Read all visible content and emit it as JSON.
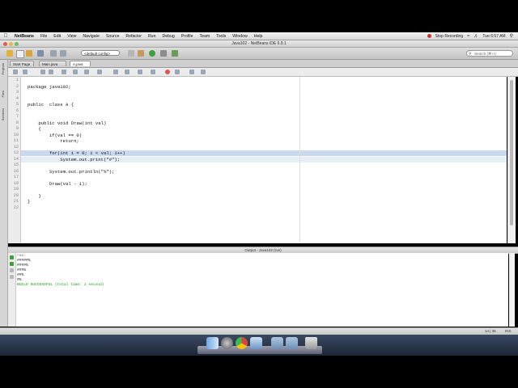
{
  "menubar": {
    "app_name": "NetBeans",
    "menus": [
      "File",
      "Edit",
      "View",
      "Navigate",
      "Source",
      "Refactor",
      "Run",
      "Debug",
      "Profile",
      "Team",
      "Tools",
      "Window",
      "Help"
    ],
    "recording": "Stop Recording",
    "clock": "Tue 6:57 AM"
  },
  "window": {
    "title": "Java102 - NetBeans IDE 6.9.1"
  },
  "toolbar": {
    "config": "<default config>",
    "search_placeholder": "Search (⌘+I)"
  },
  "sidebar_tabs": [
    "Projects",
    "Files",
    "Services"
  ],
  "editor_tabs": [
    {
      "label": "Start Page"
    },
    {
      "label": "Main.java"
    },
    {
      "label": "A.java",
      "active": true
    }
  ],
  "editor": {
    "lines": [
      {
        "n": "1",
        "code": ""
      },
      {
        "n": "2",
        "code": "package java102;"
      },
      {
        "n": "3",
        "code": ""
      },
      {
        "n": "4",
        "code": ""
      },
      {
        "n": "5",
        "code": "public  class A {"
      },
      {
        "n": "6",
        "code": ""
      },
      {
        "n": "7",
        "code": ""
      },
      {
        "n": "8",
        "code": "    public void Draw(int val)"
      },
      {
        "n": "9",
        "code": "    {"
      },
      {
        "n": "10",
        "code": "        if(val == 0)"
      },
      {
        "n": "11",
        "code": "            return;"
      },
      {
        "n": "12",
        "code": ""
      },
      {
        "n": "13",
        "code": "        for(int i = 0; i < val; i++)"
      },
      {
        "n": "14",
        "code": "            System.out.print(\"#\");"
      },
      {
        "n": "15",
        "code": ""
      },
      {
        "n": "16",
        "code": "        System.out.println(\"%\");"
      },
      {
        "n": "17",
        "code": ""
      },
      {
        "n": "18",
        "code": "        Draw(val - 1);"
      },
      {
        "n": "19",
        "code": ""
      },
      {
        "n": "20",
        "code": "    }"
      },
      {
        "n": "21",
        "code": "}"
      },
      {
        "n": "22",
        "code": ""
      }
    ]
  },
  "output": {
    "title": "Output - Java102 (run)",
    "lines": [
      "run:",
      "#####%",
      "####%",
      "###%",
      "##%",
      "#%",
      "BUILD SUCCESSFUL (total time: 1 second)"
    ]
  },
  "statusbar": {
    "position": "14 | 35",
    "mode": "INS"
  },
  "colors": {
    "highlight": "#c9d9f0",
    "keyword": "#0000e6",
    "build_success": "#1a9a1a",
    "method_highlight": "#f5f0a8"
  }
}
